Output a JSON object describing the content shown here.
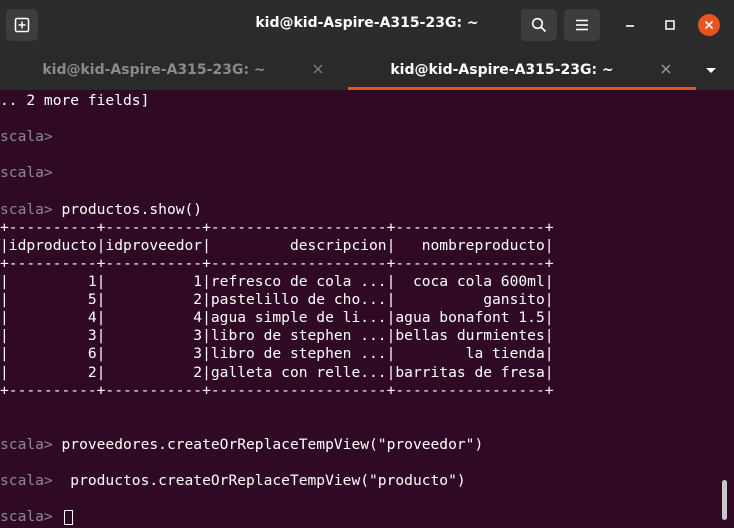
{
  "window": {
    "title": "kid@kid-Aspire-A315-23G: ~"
  },
  "tabs": [
    {
      "label": "kid@kid-Aspire-A315-23G: ~",
      "active": false
    },
    {
      "label": "kid@kid-Aspire-A315-23G: ~",
      "active": true
    }
  ],
  "icons": {
    "new_tab": "new-tab-icon",
    "search": "search-icon",
    "menu": "hamburger-menu-icon",
    "minimize": "minimize-icon",
    "maximize": "maximize-icon",
    "close": "close-icon",
    "tab_close": "tab-close-icon",
    "tab_list": "chevron-down-icon"
  },
  "colors": {
    "terminal_bg": "#300a24",
    "accent": "#e95420",
    "text": "#ffffff",
    "prompt": "#8a8a8a"
  },
  "terminal": {
    "lines": [
      {
        "prompt": "",
        "text": ".. 2 more fields]"
      },
      {
        "prompt": "",
        "text": ""
      },
      {
        "prompt": "scala>",
        "text": ""
      },
      {
        "prompt": "",
        "text": ""
      },
      {
        "prompt": "scala>",
        "text": ""
      },
      {
        "prompt": "",
        "text": ""
      },
      {
        "prompt": "scala>",
        "text": " productos.show()"
      },
      {
        "prompt": "",
        "text": "+----------+-----------+--------------------+-----------------+"
      },
      {
        "prompt": "",
        "text": "|idproducto|idproveedor|         descripcion|   nombreproducto|"
      },
      {
        "prompt": "",
        "text": "+----------+-----------+--------------------+-----------------+"
      },
      {
        "prompt": "",
        "text": "|         1|          1|refresco de cola ...|  coca cola 600ml|"
      },
      {
        "prompt": "",
        "text": "|         5|          2|pastelillo de cho...|          gansito|"
      },
      {
        "prompt": "",
        "text": "|         4|          4|agua simple de li...|agua bonafont 1.5|"
      },
      {
        "prompt": "",
        "text": "|         3|          3|libro de stephen ...|bellas durmientes|"
      },
      {
        "prompt": "",
        "text": "|         6|          3|libro de stephen ...|        la tienda|"
      },
      {
        "prompt": "",
        "text": "|         2|          2|galleta con relle...|barritas de fresa|"
      },
      {
        "prompt": "",
        "text": "+----------+-----------+--------------------+-----------------+"
      },
      {
        "prompt": "",
        "text": ""
      },
      {
        "prompt": "",
        "text": ""
      },
      {
        "prompt": "scala>",
        "text": " proveedores.createOrReplaceTempView(\"proveedor\")"
      },
      {
        "prompt": "",
        "text": ""
      },
      {
        "prompt": "scala>",
        "text": "  productos.createOrReplaceTempView(\"producto\")"
      },
      {
        "prompt": "",
        "text": ""
      },
      {
        "prompt": "scala>",
        "text": " ",
        "cursor": true
      }
    ]
  }
}
